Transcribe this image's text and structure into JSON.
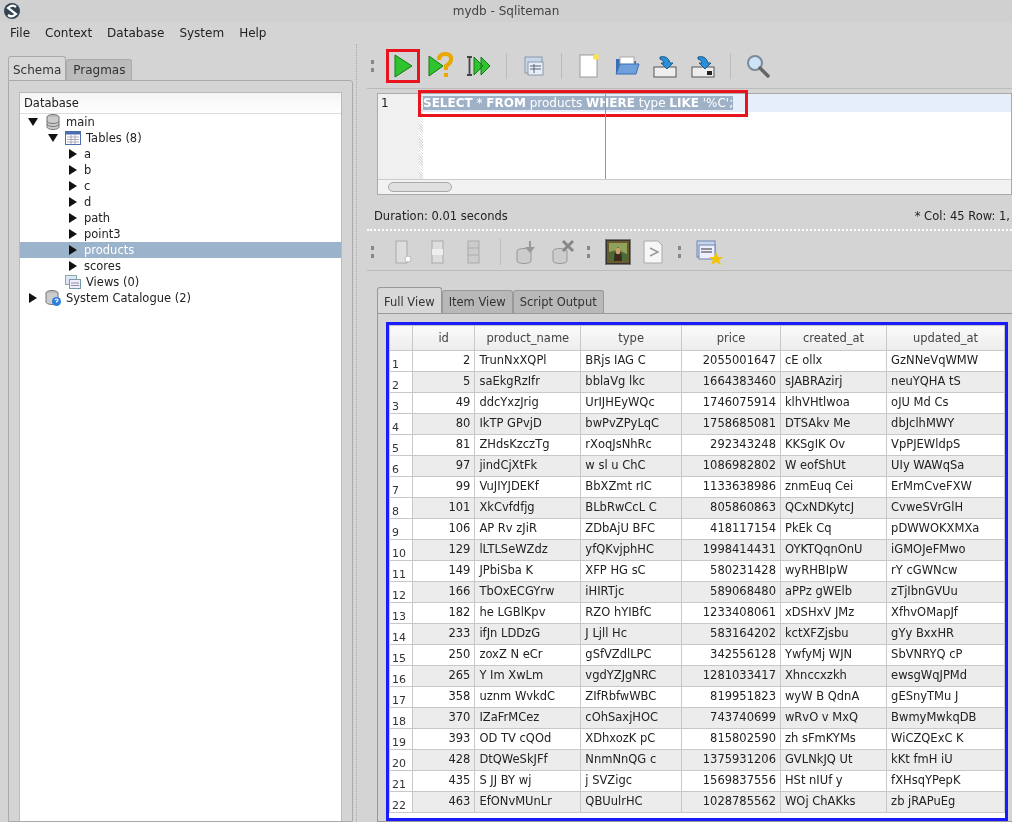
{
  "window": {
    "title": "mydb - Sqliteman"
  },
  "menu": [
    "File",
    "Context",
    "Database",
    "System",
    "Help"
  ],
  "left_tabs": [
    {
      "label": "Schema",
      "selected": true
    },
    {
      "label": "Pragmas",
      "selected": false
    }
  ],
  "tree": {
    "header": "Database",
    "nodes": [
      {
        "label": "main",
        "kind": "database",
        "expanded": true,
        "selected": false,
        "children": [
          {
            "label": "Tables (8)",
            "kind": "tables",
            "expanded": true,
            "selected": false,
            "children": [
              {
                "label": "a",
                "expanded": false,
                "selected": false
              },
              {
                "label": "b",
                "expanded": false,
                "selected": false
              },
              {
                "label": "c",
                "expanded": false,
                "selected": false
              },
              {
                "label": "d",
                "expanded": false,
                "selected": false
              },
              {
                "label": "path",
                "expanded": false,
                "selected": false
              },
              {
                "label": "point3",
                "expanded": false,
                "selected": false
              },
              {
                "label": "products",
                "expanded": false,
                "selected": true
              },
              {
                "label": "scores",
                "expanded": false,
                "selected": false
              }
            ]
          },
          {
            "label": "Views (0)",
            "kind": "views",
            "selected": false
          }
        ]
      },
      {
        "label": "System Catalogue (2)",
        "kind": "catalog",
        "expanded": false,
        "selected": false
      }
    ]
  },
  "toolbar": {
    "run_highlighted": true
  },
  "editor": {
    "line_number": "1",
    "sql": "**SELECT** * **FROM** products **WHERE** type **LIKE** '%C';",
    "highlighted": true
  },
  "status": {
    "duration": "Duration: 0.01 seconds",
    "position": "*  Col: 45 Row: 1,"
  },
  "result_tabs": [
    {
      "label": "Full View",
      "selected": true
    },
    {
      "label": "Item View",
      "selected": false
    },
    {
      "label": "Script Output",
      "selected": false
    }
  ],
  "table": {
    "highlighted": true,
    "columns": [
      "id",
      "product_name",
      "type",
      "price",
      "created_at",
      "updated_at"
    ],
    "rows": [
      {
        "row_header": "1",
        "cells": [
          "2",
          "TrunNxXQPl",
          "BRjs IAG C",
          "2055001647",
          "cE ollx",
          "GzNNeVqWMW"
        ]
      },
      {
        "row_header": "2",
        "cells": [
          "5",
          "saEkgRzIfr",
          "bblaVg lkc",
          "1664383460",
          "sJABRAzirj",
          "neuYQHA tS"
        ]
      },
      {
        "row_header": "3",
        "cells": [
          "49",
          "ddcYxzJrig",
          "UrIJHEyWQc",
          "1746075914",
          "klhVHtlwoa",
          "oJU Md Cs"
        ]
      },
      {
        "row_header": "4",
        "cells": [
          "80",
          "IkTP GPvjD",
          "bwPvZPyLqC",
          "1758685081",
          "DTSAkv Me",
          "dbJclhMWY"
        ]
      },
      {
        "row_header": "5",
        "cells": [
          "81",
          "ZHdsKzczTg",
          "rXoqJsNhRc",
          "292343248",
          "KKSgIK Ov",
          "VpPJEWldpS"
        ]
      },
      {
        "row_header": "6",
        "cells": [
          "97",
          "jindCjXtFk",
          "w sl u ChC",
          "1086982802",
          "W eofShUt",
          "UIy WAWqSa"
        ]
      },
      {
        "row_header": "7",
        "cells": [
          "99",
          "VuJIYJDEKf",
          "BbXZmt rIC",
          "1133638986",
          "znmEuq Cei",
          "ErMmCveFXW"
        ]
      },
      {
        "row_header": "8",
        "cells": [
          "101",
          "XkCvfdfjg",
          "BLbRwCcL C",
          "805860863",
          "QCxNDKytcJ",
          "CvweSVrGlH"
        ]
      },
      {
        "row_header": "9",
        "cells": [
          "106",
          "AP Rv zJiR",
          "ZDbAjU BFC",
          "418117154",
          "PkEk Cq",
          "pDWWOKXMXa"
        ]
      },
      {
        "row_header": "10",
        "cells": [
          "129",
          "lLTLSeWZdz",
          "yfQKvjphHC",
          "1998414431",
          "OYKTQqnOnU",
          "iGMOJeFMwo"
        ]
      },
      {
        "row_header": "11",
        "cells": [
          "149",
          "JPbiSba K",
          "XFP HG sC",
          "580231428",
          "wyRHBIpW",
          "rY cGWNcw"
        ]
      },
      {
        "row_header": "12",
        "cells": [
          "166",
          "TbOxECGYrw",
          "iHIRTjc",
          "589068480",
          "aPPz gWElb",
          "zTjIbnGVUu"
        ]
      },
      {
        "row_header": "13",
        "cells": [
          "182",
          "he LGBlKpv",
          "RZO hYIBfC",
          "1233408061",
          "xDSHxV JMz",
          "XfhvOMapJf"
        ]
      },
      {
        "row_header": "14",
        "cells": [
          "233",
          "ifJn LDDzG",
          "J Ljll Hc",
          "583164202",
          "kctXFZjsbu",
          "gYy BxxHR"
        ]
      },
      {
        "row_header": "15",
        "cells": [
          "250",
          "zoxZ N eCr",
          "gSfVZdlLPC",
          "342556128",
          "YwfyMj WJN",
          "SbVNRYQ cP"
        ]
      },
      {
        "row_header": "16",
        "cells": [
          "265",
          "Y Im XwLm",
          "vgdYZJgNRC",
          "1281033417",
          "Xhnccxzkh",
          "ewsgWqJPMd"
        ]
      },
      {
        "row_header": "17",
        "cells": [
          "358",
          "uznm WvkdC",
          "ZIfRbfwWBC",
          "819951823",
          "wyW B QdnA",
          "gESnyTMu J"
        ]
      },
      {
        "row_header": "18",
        "cells": [
          "370",
          "IZaFrMCez",
          "cOhSaxjHOC",
          "743740699",
          "wRvO v MxQ",
          "BwmyMwkqDB"
        ]
      },
      {
        "row_header": "19",
        "cells": [
          "393",
          "OD TV cQOd",
          "XDhxozK pC",
          "815802590",
          "zh sFmKYMs",
          "WiCZQExC K"
        ]
      },
      {
        "row_header": "20",
        "cells": [
          "428",
          "DtQWeSkJFf",
          "NnmNnQG c",
          "1375931206",
          "GVLNkJQ Ut",
          "kKt fmH iU"
        ]
      },
      {
        "row_header": "21",
        "cells": [
          "435",
          "S JJ BY wj",
          "j SVZigc",
          "1569837556",
          "HSt nIUf y",
          "fXHsqYPepK"
        ]
      },
      {
        "row_header": "22",
        "cells": [
          "463",
          "EfONvMUnLr",
          "QBUulrHC",
          "1028785562",
          "WOj ChAKks",
          "zb jRAPuEg"
        ]
      }
    ]
  }
}
